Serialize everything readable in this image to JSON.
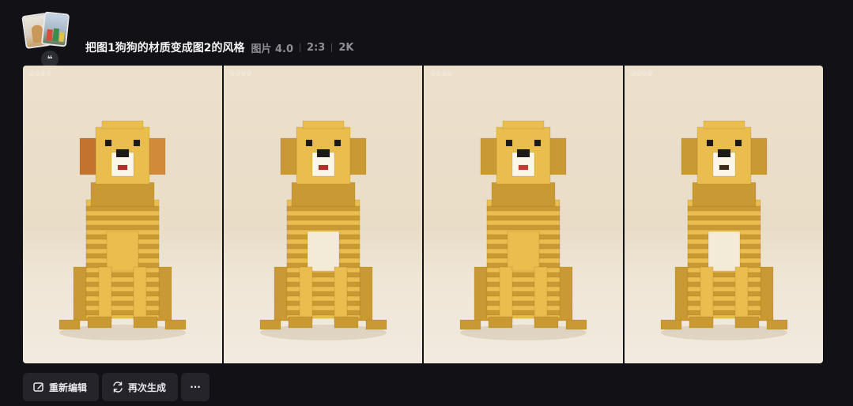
{
  "header": {
    "prompt": "把图1狗狗的材质变成图2的风格",
    "model": "图片 4.0",
    "ratio": "2:3",
    "resolution": "2K",
    "quote_glyph": "❝"
  },
  "images": [
    {
      "watermark": "@@@@"
    },
    {
      "watermark": "@@@@"
    },
    {
      "watermark": "@@@@"
    },
    {
      "watermark": "@@@@"
    }
  ],
  "actions": {
    "edit_label": "重新编辑",
    "regenerate_label": "再次生成",
    "more_label": "···"
  },
  "icons": {
    "edit": "edit-icon",
    "regenerate": "refresh-icon",
    "more": "more-icon",
    "quote": "quote-icon"
  },
  "colors": {
    "background": "#121216",
    "button": "#24242a",
    "lego_yellow": "#e9bd4e",
    "lego_shadow": "#c99a33"
  }
}
